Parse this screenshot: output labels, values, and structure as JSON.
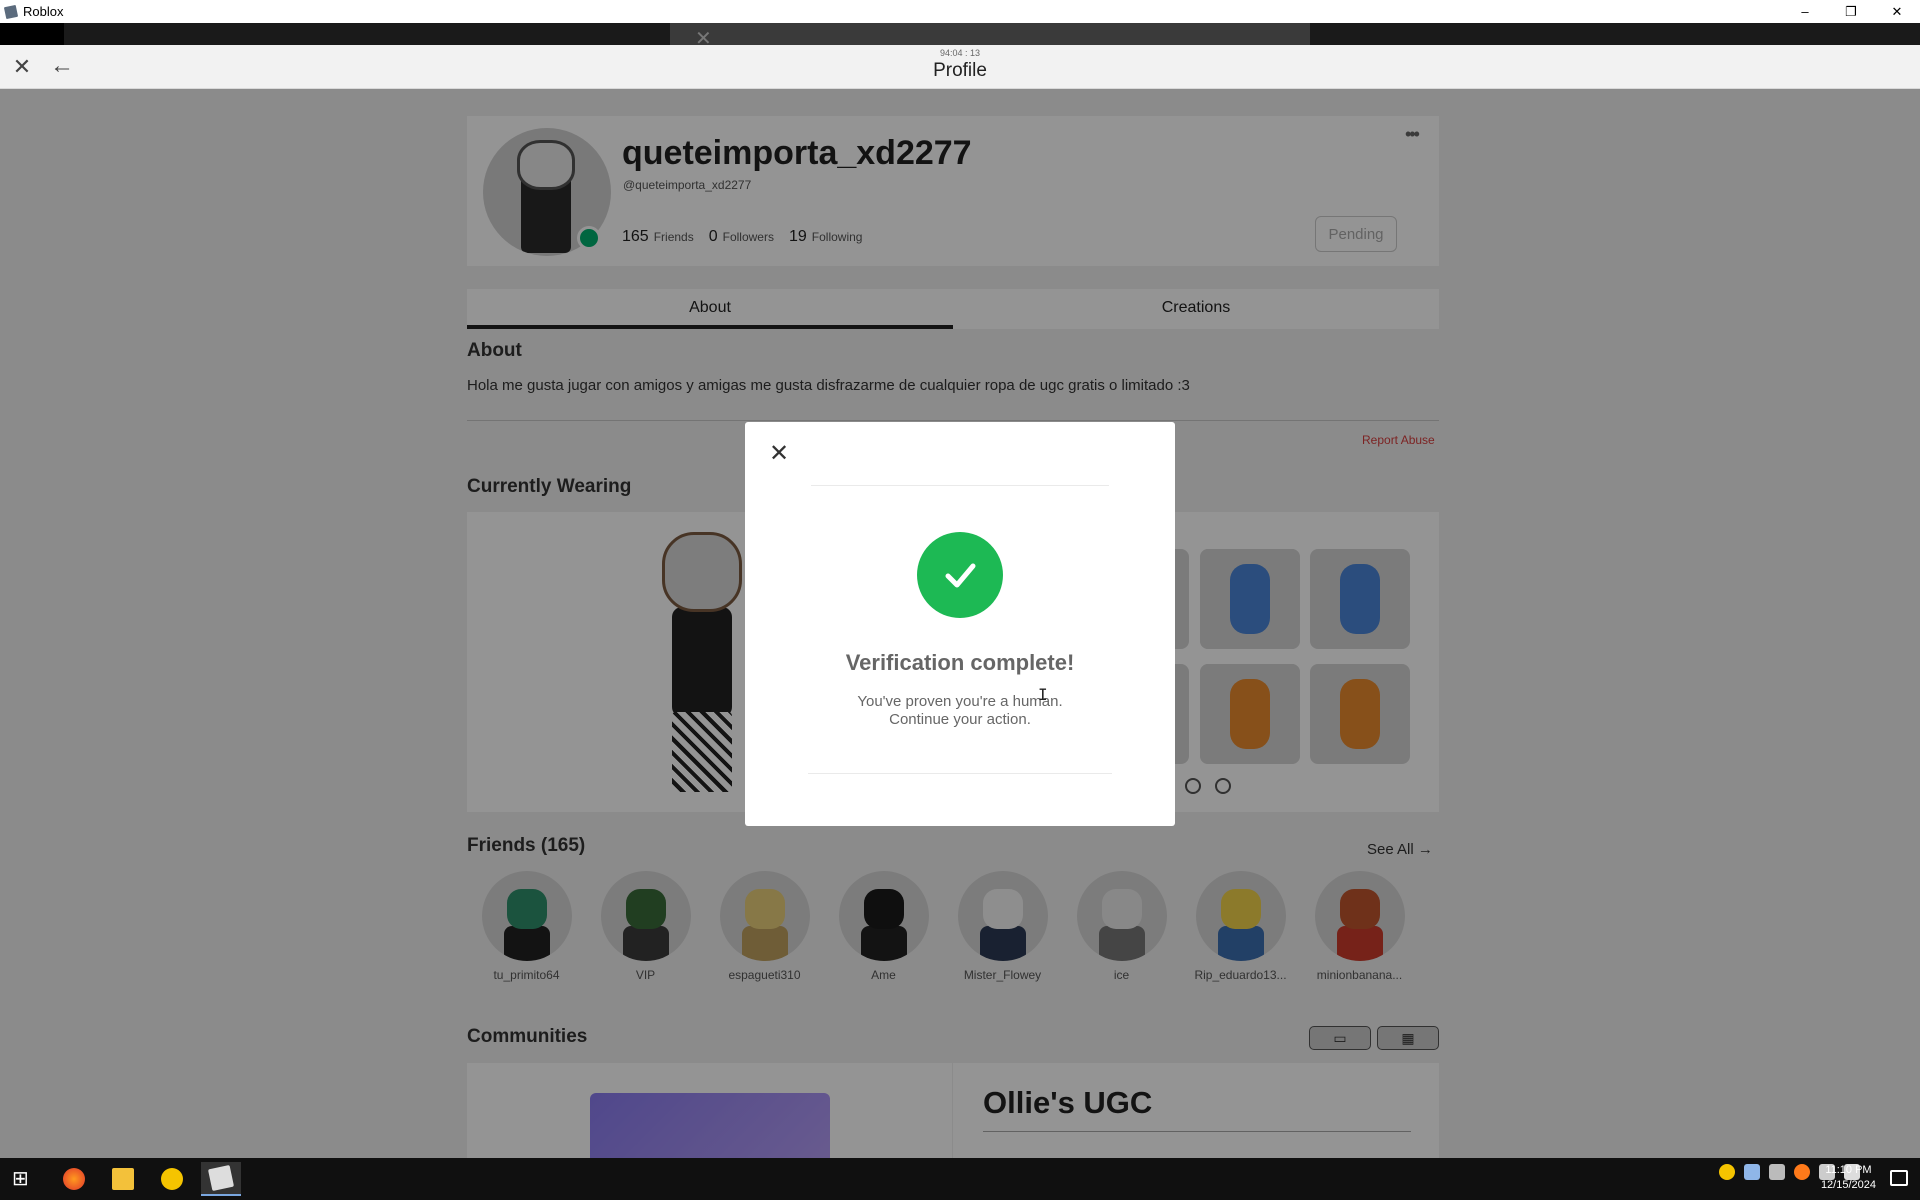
{
  "window": {
    "title": "Roblox",
    "minimize": "–",
    "restore": "❐",
    "close": "✕"
  },
  "header": {
    "title": "Profile",
    "timer": "94:04 : 13",
    "close_icon": "✕",
    "back_icon": "←"
  },
  "profile": {
    "display_name": "queteimporta_xd2277",
    "username": "@queteimporta_xd2277",
    "friends_count": "165",
    "friends_label": "Friends",
    "followers_count": "0",
    "followers_label": "Followers",
    "following_count": "19",
    "following_label": "Following",
    "pending_label": "Pending",
    "more_label": "•••"
  },
  "tabs": [
    {
      "label": "About",
      "active": true
    },
    {
      "label": "Creations",
      "active": false
    }
  ],
  "about": {
    "heading": "About",
    "text": "Hola me gusta jugar con amigos y amigas me gusta disfrazarme de cualquier ropa de ugc gratis o limitado :3",
    "report_abuse": "Report Abuse"
  },
  "wearing": {
    "heading": "Currently Wearing"
  },
  "friends": {
    "heading": "Friends (165)",
    "see_all": "See All →",
    "items": [
      {
        "name": "tu_primito64"
      },
      {
        "name": "VIP"
      },
      {
        "name": "espagueti310"
      },
      {
        "name": "Ame"
      },
      {
        "name": "Mister_Flowey"
      },
      {
        "name": "ice"
      },
      {
        "name": "Rip_eduardo13..."
      },
      {
        "name": "minionbanana..."
      }
    ]
  },
  "communities": {
    "heading": "Communities",
    "name": "Ollie's UGC"
  },
  "modal": {
    "title": "Verification complete!",
    "line1": "You've proven you're a human.",
    "line2": "Continue your action.",
    "close_icon": "✕"
  },
  "taskbar": {
    "time": "11:10 PM",
    "date": "12/15/2024"
  },
  "colors": {
    "success": "#1db954",
    "presence": "#00b06f",
    "report": "#d63d3d"
  }
}
